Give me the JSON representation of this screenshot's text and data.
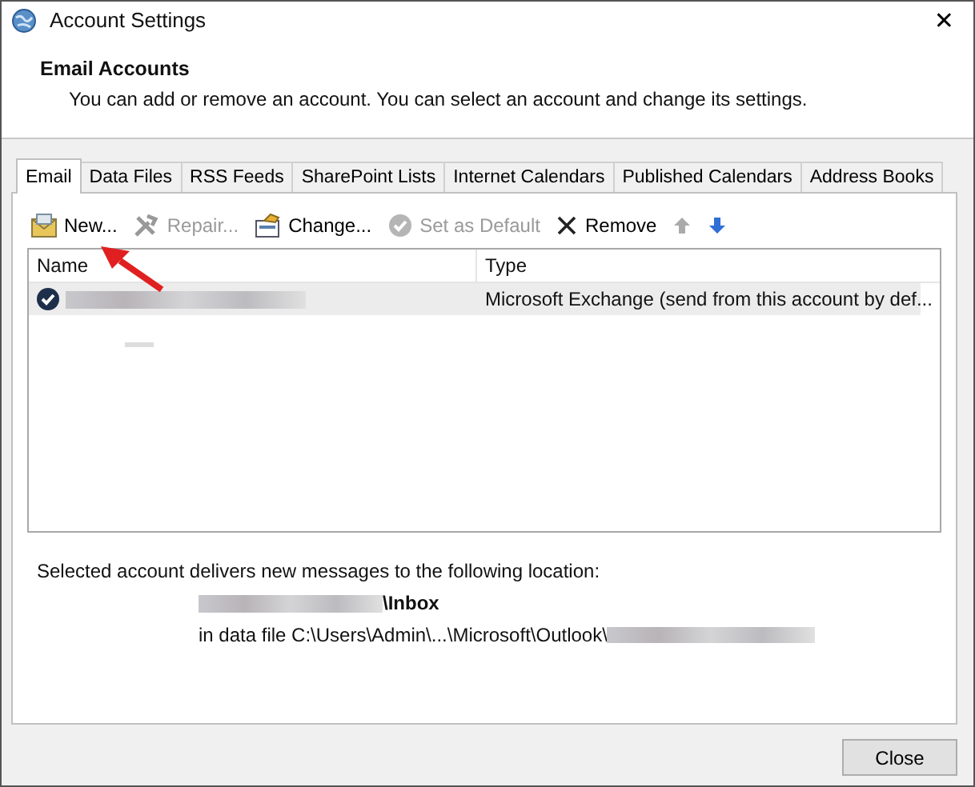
{
  "window": {
    "title": "Account Settings",
    "close": "✕"
  },
  "header": {
    "title": "Email Accounts",
    "description": "You can add or remove an account. You can select an account and change its settings."
  },
  "tabs": [
    {
      "label": "Email",
      "selected": true
    },
    {
      "label": "Data Files",
      "selected": false
    },
    {
      "label": "RSS Feeds",
      "selected": false
    },
    {
      "label": "SharePoint Lists",
      "selected": false
    },
    {
      "label": "Internet Calendars",
      "selected": false
    },
    {
      "label": "Published Calendars",
      "selected": false
    },
    {
      "label": "Address Books",
      "selected": false
    }
  ],
  "toolbar": [
    {
      "kind": "new",
      "label": "New...",
      "disabled": false
    },
    {
      "kind": "repair",
      "label": "Repair...",
      "disabled": true
    },
    {
      "kind": "change",
      "label": "Change...",
      "disabled": false
    },
    {
      "kind": "default",
      "label": "Set as Default",
      "disabled": true
    },
    {
      "kind": "remove",
      "label": "Remove",
      "disabled": false
    },
    {
      "kind": "up",
      "disabled": true
    },
    {
      "kind": "down",
      "disabled": false
    }
  ],
  "table": {
    "columns": [
      "Name",
      "Type"
    ],
    "rows": [
      {
        "type": "Microsoft Exchange (send from this account by def...",
        "selected": true,
        "default": true
      }
    ]
  },
  "location": {
    "caption": "Selected account delivers new messages to the following location:",
    "folder": "\\Inbox",
    "data_file": "in data file C:\\Users\\Admin\\...\\Microsoft\\Outlook\\"
  },
  "buttons": [
    {
      "label": "Close"
    }
  ]
}
